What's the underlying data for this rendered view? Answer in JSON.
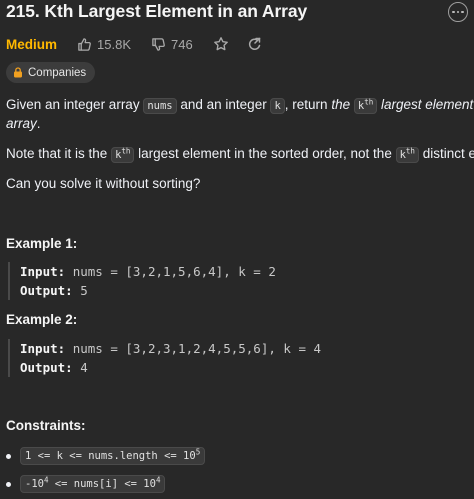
{
  "problem": {
    "title": "215. Kth Largest Element in an Array",
    "difficulty": "Medium",
    "likes": "15.8K",
    "dislikes": "746",
    "companies_label": "Companies"
  },
  "description": {
    "p1_a": "Given an integer array ",
    "p1_code_nums": "nums",
    "p1_b": " and an integer ",
    "p1_code_k": "k",
    "p1_c": ", return ",
    "p1_em_the": "the",
    "p1_code_kth_base": "k",
    "p1_code_kth_sup": "th",
    "p1_em_rest1": " largest element in the",
    "p1_em_rest2": "array",
    "p1_period": ".",
    "p2_a": "Note that it is the ",
    "p2_kth1_base": "k",
    "p2_kth1_sup": "th",
    "p2_b": " largest element in the sorted order, not the ",
    "p2_kth2_base": "k",
    "p2_kth2_sup": "th",
    "p2_c": " distinct element.",
    "p3": "Can you solve it without sorting?"
  },
  "examples": [
    {
      "heading": "Example 1:",
      "input_label": "Input:",
      "input_value": "nums = [3,2,1,5,6,4], k = 2",
      "output_label": "Output:",
      "output_value": "5"
    },
    {
      "heading": "Example 2:",
      "input_label": "Input:",
      "input_value": "nums = [3,2,3,1,2,4,5,5,6], k = 4",
      "output_label": "Output:",
      "output_value": "4"
    }
  ],
  "constraints": {
    "heading": "Constraints:",
    "c1_base": "1 <= k <= nums.length <= 10",
    "c1_sup": "5",
    "c2_a": "-10",
    "c2_sup1": "4",
    "c2_b": " <= nums[i] <= 10",
    "c2_sup2": "4"
  },
  "colors": {
    "background": "#282828",
    "medium": "#ffb800",
    "text": "#eff1f6",
    "code_bg": "#3a3a3a"
  },
  "icons": [
    "more-icon",
    "thumbs-up-icon",
    "thumbs-down-icon",
    "star-icon",
    "share-icon",
    "lock-icon"
  ]
}
